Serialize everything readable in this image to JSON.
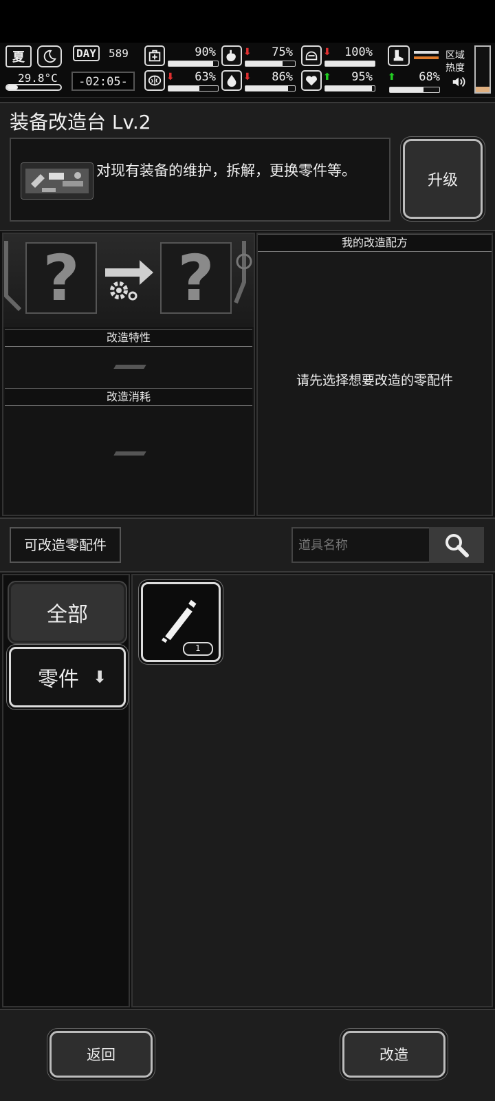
{
  "hud": {
    "season": "夏",
    "temperature": "29.8°C",
    "day_label": "DAY",
    "day_number": "589",
    "time": "-02:05-",
    "stats": [
      {
        "name": "health",
        "icon": "medkit-icon",
        "value": "90%",
        "fill": 0.9,
        "trend": ""
      },
      {
        "name": "hunger",
        "icon": "stomach-icon",
        "value": "75%",
        "fill": 0.75,
        "trend": "down"
      },
      {
        "name": "armor",
        "icon": "helmet-icon",
        "value": "100%",
        "fill": 1.0,
        "trend": "down"
      },
      {
        "name": "sanity",
        "icon": "brain-icon",
        "value": "63%",
        "fill": 0.63,
        "trend": "down"
      },
      {
        "name": "thirst",
        "icon": "water-drop-icon",
        "value": "86%",
        "fill": 0.86,
        "trend": "down"
      },
      {
        "name": "mood",
        "icon": "heart-icon",
        "value": "95%",
        "fill": 0.95,
        "trend": "up"
      },
      {
        "name": "stamina",
        "value": "68%",
        "fill": 0.68,
        "trend": "up"
      }
    ],
    "zone_heat_label": "区域\n热度",
    "zone_heat_fill": 0.12
  },
  "station": {
    "title": "装备改造台 Lv.2",
    "description": "对现有装备的维护，拆解，更换零件等。",
    "upgrade_label": "升级"
  },
  "modify": {
    "input_placeholder": "?",
    "output_placeholder": "?",
    "traits_title": "改造特性",
    "cost_title": "改造消耗"
  },
  "recipes": {
    "title": "我的改造配方",
    "empty_hint": "请先选择想要改造的零配件"
  },
  "filter": {
    "modifiable_label": "可改造零配件",
    "search_placeholder": "道具名称"
  },
  "categories": [
    {
      "label": "全部",
      "selected": true
    },
    {
      "label": "零件",
      "selected": false
    }
  ],
  "inventory": [
    {
      "name": "tube-item",
      "count": "1"
    }
  ],
  "footer": {
    "back_label": "返回",
    "modify_label": "改造"
  },
  "colors": {
    "accent_orange": "#e07b2a",
    "trend_down": "#e03030",
    "trend_up": "#22cc22"
  }
}
